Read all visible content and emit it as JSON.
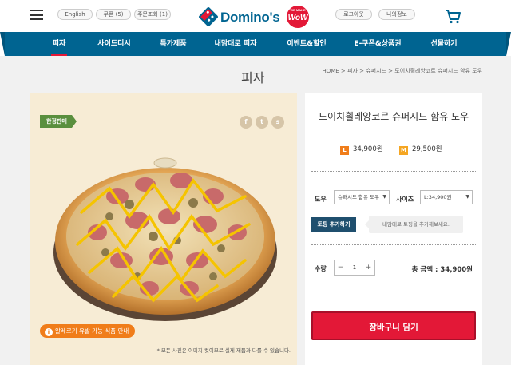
{
  "header": {
    "language": "English",
    "coupon": "쿠폰 (5)",
    "order_lookup": "주문조회 (1)",
    "logo_text": "Domino's",
    "logo_badge_small": "WE MAKE",
    "logo_badge": "WoW",
    "login": "로그아웃",
    "my_info": "나의정보",
    "cart_icon": "shopping-cart-icon",
    "menu_icon": "hamburger-menu-icon"
  },
  "nav": {
    "items": [
      "피자",
      "사이드디시",
      "특가제품",
      "내맘대로 피자",
      "이벤트&할인",
      "E-쿠폰&상품권",
      "선물하기"
    ],
    "active_index": 0
  },
  "page": {
    "title": "피자",
    "breadcrumb": "HOME > 피자 > 슈퍼시드 > 도이치휠레앙코르 슈퍼시드 함유 도우"
  },
  "product_image": {
    "badge": "한정판매",
    "share_icons": [
      "facebook-icon",
      "twitter-icon",
      "kakaostory-icon"
    ],
    "share_glyphs": [
      "f",
      "t",
      "s"
    ],
    "allergy_button": "알레르기 유발 가능 식품 안내",
    "note": "* 모든 사진은 이미지 컷이므로 실제 제품과 다를 수 있습니다."
  },
  "product": {
    "name": "도이치휠레앙코르 슈퍼시드 함유 도우",
    "price_large_tag": "L",
    "price_large": "34,900원",
    "price_medium_tag": "M",
    "price_medium": "29,500원",
    "dough_label": "도우",
    "dough_value": "슈퍼시드 함유 도우",
    "size_label": "사이즈",
    "size_value": "L:34,900원",
    "topping_button": "토핑 추가하기",
    "topping_note": "내맘대로 토핑을 추가해보세요.",
    "quantity_label": "수량",
    "quantity": "1",
    "quantity_minus": "−",
    "quantity_plus": "+",
    "total": "총 금액 : 34,900원",
    "cart_button": "장바구니 담기"
  },
  "colors": {
    "brand_blue": "#006491",
    "brand_red": "#e31837",
    "accent_orange": "#f07d1a",
    "badge_green": "#5a8f3e"
  }
}
